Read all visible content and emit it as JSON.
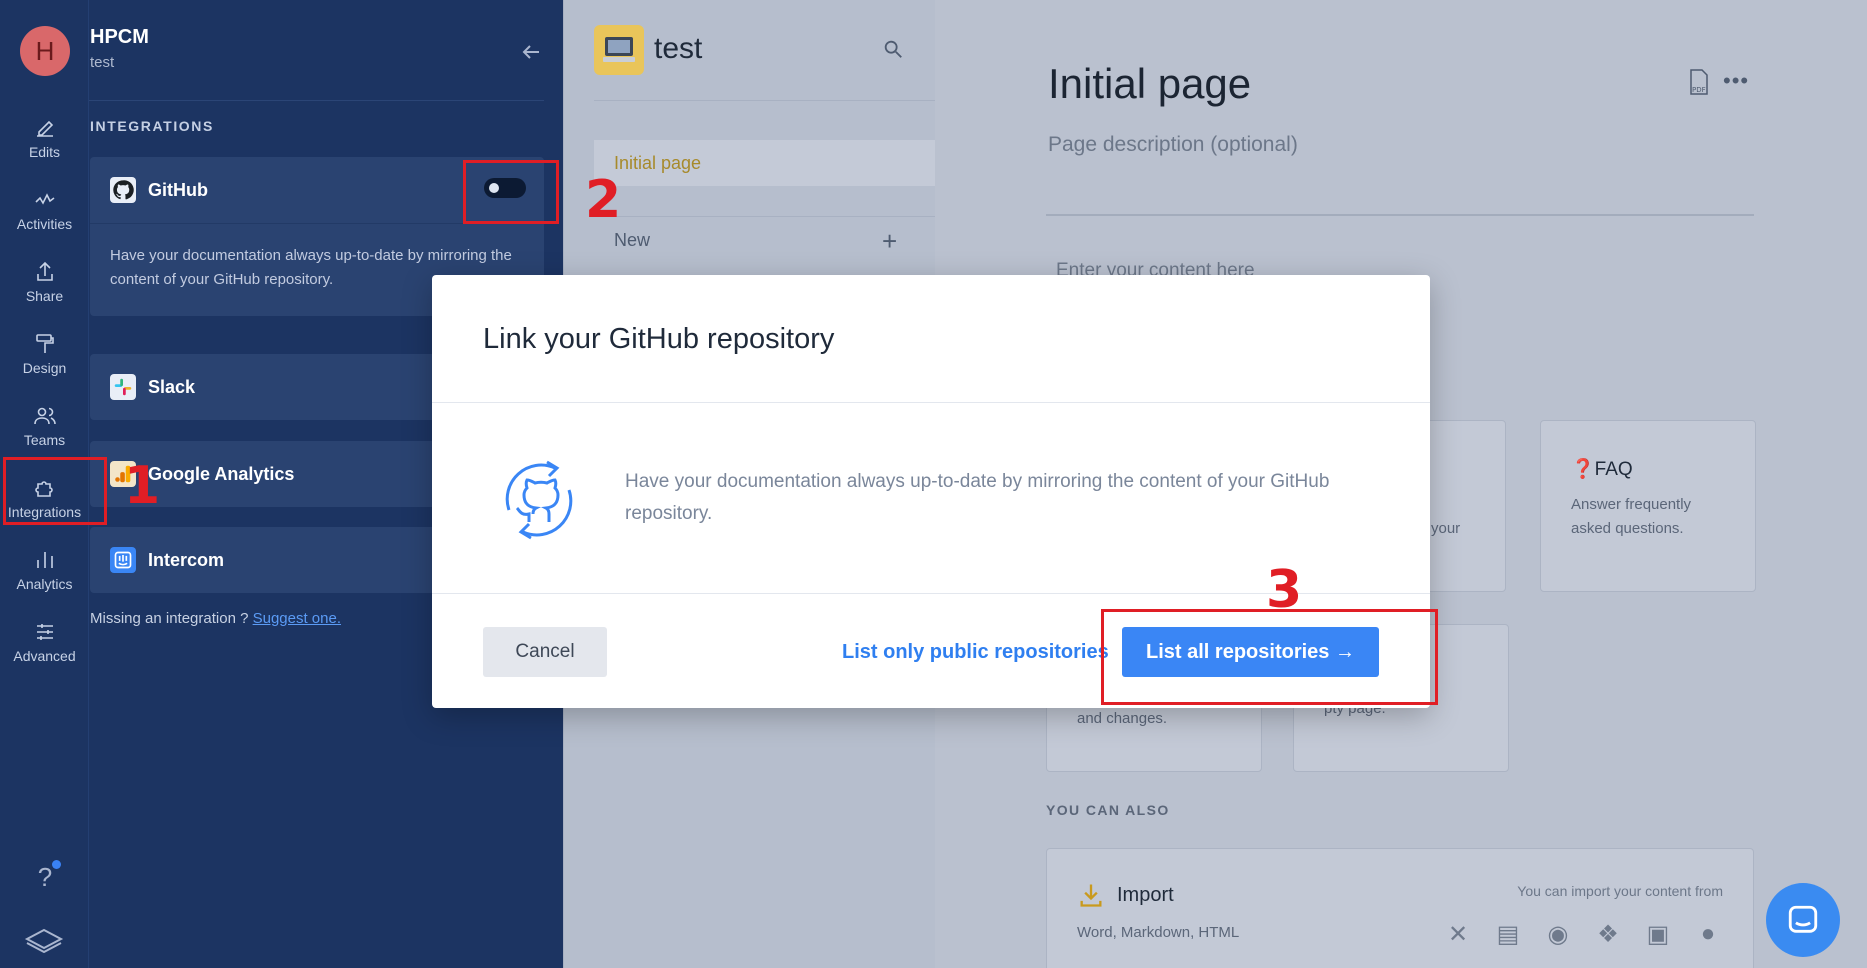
{
  "workspace": {
    "avatar_letter": "H",
    "name": "HPCM",
    "space": "test"
  },
  "rail": {
    "items": [
      {
        "label": "Edits",
        "icon": "pencil-icon"
      },
      {
        "label": "Activities",
        "icon": "activity-icon"
      },
      {
        "label": "Share",
        "icon": "share-icon"
      },
      {
        "label": "Design",
        "icon": "paint-roller-icon"
      },
      {
        "label": "Teams",
        "icon": "people-icon"
      },
      {
        "label": "Integrations",
        "icon": "puzzle-icon"
      },
      {
        "label": "Analytics",
        "icon": "bar-chart-icon"
      },
      {
        "label": "Advanced",
        "icon": "sliders-icon"
      }
    ],
    "help_label": "?"
  },
  "integrations": {
    "section_title": "INTEGRATIONS",
    "github": {
      "name": "GitHub",
      "description": "Have your documentation always up-to-date by mirroring the content of your GitHub repository.",
      "enabled": false
    },
    "slack": {
      "name": "Slack"
    },
    "google_analytics": {
      "name": "Google Analytics"
    },
    "intercom": {
      "name": "Intercom"
    },
    "missing_text": "Missing an integration ? ",
    "suggest_link": "Suggest one."
  },
  "pages": {
    "space_title": "test",
    "active_page": "Initial page",
    "new_label": "New",
    "new_plus": "+"
  },
  "editor": {
    "title": "Initial page",
    "description_placeholder": "Page description (optional)",
    "content_placeholder": "Enter your content here",
    "pdf_label": "PDF",
    "more_label": "•••",
    "templates": [
      {
        "title": "FAQ",
        "text": "Answer frequently asked questions."
      },
      {
        "text_fragment": "your"
      },
      {
        "text_fragment": "and changes."
      },
      {
        "text_fragment": "pty page."
      }
    ],
    "you_can_also": "YOU CAN ALSO",
    "import": {
      "title": "Import",
      "subtitle": "Word, Markdown, HTML",
      "right_text": "You can import your content from"
    }
  },
  "modal": {
    "title": "Link your GitHub repository",
    "description": "Have your documentation always up-to-date by mirroring the content of your GitHub repository.",
    "cancel_label": "Cancel",
    "public_label": "List only public repositories",
    "all_label": "List all repositories →"
  },
  "annotations": {
    "step1": "1",
    "step2": "2",
    "step3": "3"
  },
  "colors": {
    "sidebar": "#1c3462",
    "accent": "#3a86f5",
    "annotation": "#e01e25",
    "active_page": "#a78a2b"
  }
}
